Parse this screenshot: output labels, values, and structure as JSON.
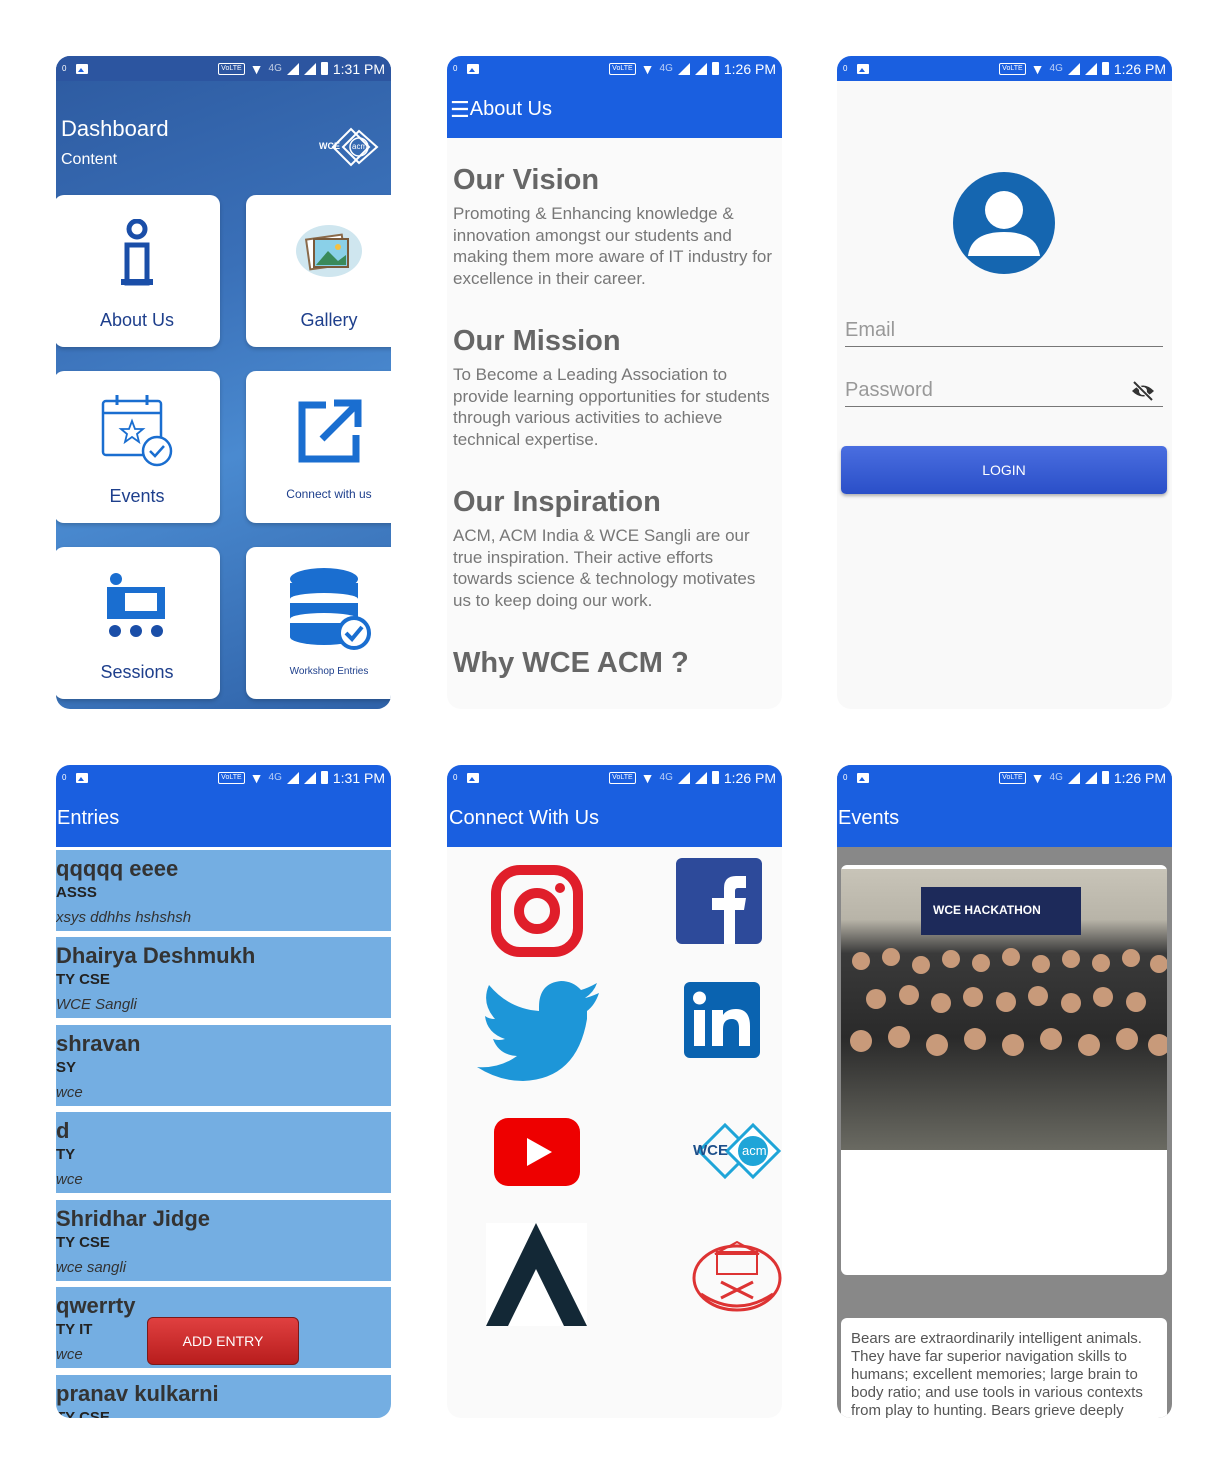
{
  "status_bar": {
    "kbs_label": "KB/s",
    "zero": "0",
    "volte": "VoLTE",
    "net": "4G",
    "time_1_31": "1:31 PM",
    "time_1_26": "1:26 PM"
  },
  "dashboard": {
    "title": "Dashboard",
    "subtitle": "Content",
    "logo_text": "WCE",
    "logo_acm": "acm",
    "tiles": [
      {
        "label": "About Us",
        "icon": "info-icon"
      },
      {
        "label": "Gallery",
        "icon": "gallery-icon"
      },
      {
        "label": "Events",
        "icon": "calendar-icon"
      },
      {
        "label": "Connect with us",
        "icon": "external-link-icon"
      },
      {
        "label": "Sessions",
        "icon": "sessions-icon"
      },
      {
        "label": "Workshop Entries",
        "icon": "database-icon"
      }
    ]
  },
  "about": {
    "title": "About Us",
    "sections": [
      {
        "heading": "Our Vision",
        "text": "Promoting & Enhancing knowledge & innovation amongst our students and making them more aware of IT industry for excellence in their career."
      },
      {
        "heading": "Our Mission",
        "text": "To Become a Leading Association to provide learning opportunities for students through various activities to achieve technical expertise."
      },
      {
        "heading": "Our Inspiration",
        "text": "ACM, ACM India & WCE Sangli are our true inspiration. Their active efforts towards science & technology motivates us to keep doing our work."
      },
      {
        "heading": "Why WCE ACM ?",
        "text": ""
      }
    ]
  },
  "login": {
    "email_placeholder": "Email",
    "password_placeholder": "Password",
    "button": "LOGIN"
  },
  "entries": {
    "title": "Entries",
    "rows": [
      {
        "name": "qqqqq eeee",
        "class": "ASSS",
        "college": "xsys ddhhs hshshsh"
      },
      {
        "name": "Dhairya Deshmukh",
        "class": "TY CSE",
        "college": "WCE Sangli"
      },
      {
        "name": "shravan",
        "class": "SY",
        "college": "wce"
      },
      {
        "name": "d",
        "class": "TY",
        "college": "wce"
      },
      {
        "name": "Shridhar Jidge",
        "class": "TY CSE",
        "college": "wce sangli"
      },
      {
        "name": "qwerrty",
        "class": "TY IT",
        "college": "wce"
      },
      {
        "name": "pranav kulkarni",
        "class": "TY CSE",
        "college": ""
      }
    ],
    "add_button": "ADD ENTRY"
  },
  "connect": {
    "title": "Connect With Us",
    "links": [
      "instagram-icon",
      "facebook-icon",
      "twitter-icon",
      "linkedin-icon",
      "youtube-icon",
      "wce-acm-logo",
      "hackathon-logo",
      "college-emblem"
    ],
    "wce_text": "WCE",
    "acm_text": "acm"
  },
  "events": {
    "title": "Events",
    "banner_text": "WCE HACKATHON",
    "description": "Bears are extraordinarily intelligent animals. They have far superior navigation skills to humans; excellent memories; large brain to body ratio; and use tools in various contexts from play to hunting. Bears grieve deeply"
  },
  "colors": {
    "appbar": "#1a5fe0",
    "entry_bg": "#74aee2",
    "tile_text": "#1e3f8c",
    "add_button": "#c62828"
  }
}
